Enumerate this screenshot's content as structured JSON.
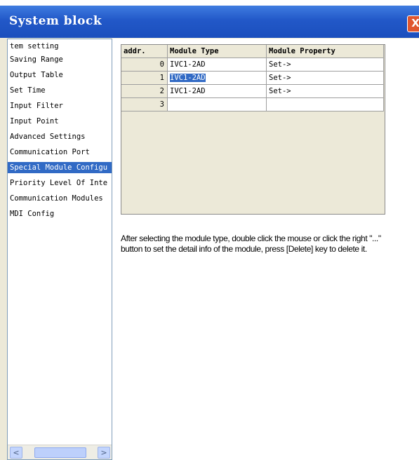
{
  "window": {
    "title": "System block",
    "close_glyph": "X"
  },
  "sidebar": {
    "items": [
      {
        "label": "tem setting"
      },
      {
        "label": "Saving Range"
      },
      {
        "label": "Output Table"
      },
      {
        "label": "Set Time"
      },
      {
        "label": "Input Filter"
      },
      {
        "label": "Input Point"
      },
      {
        "label": "Advanced Settings"
      },
      {
        "label": "Communication Port"
      },
      {
        "label": "Special Module Configu"
      },
      {
        "label": "Priority Level Of Inte"
      },
      {
        "label": "Communication Modules"
      },
      {
        "label": "MDI Config"
      }
    ],
    "scroll": {
      "left_glyph": "<",
      "right_glyph": ">"
    }
  },
  "grid": {
    "headers": {
      "addr": "addr.",
      "type": "Module Type",
      "prop": "Module Property"
    },
    "rows": [
      {
        "addr": "0",
        "type": "IVC1-2AD",
        "prop": "Set->"
      },
      {
        "addr": "1",
        "type": "IVC1-2AD",
        "prop": "Set->"
      },
      {
        "addr": "2",
        "type": "IVC1-2AD",
        "prop": "Set->"
      },
      {
        "addr": "3",
        "type": "",
        "prop": ""
      }
    ]
  },
  "info_text": "After selecting the module type, double click the mouse or click the right \"...\" button to set the detail info of the module, press [Delete] key to delete it."
}
